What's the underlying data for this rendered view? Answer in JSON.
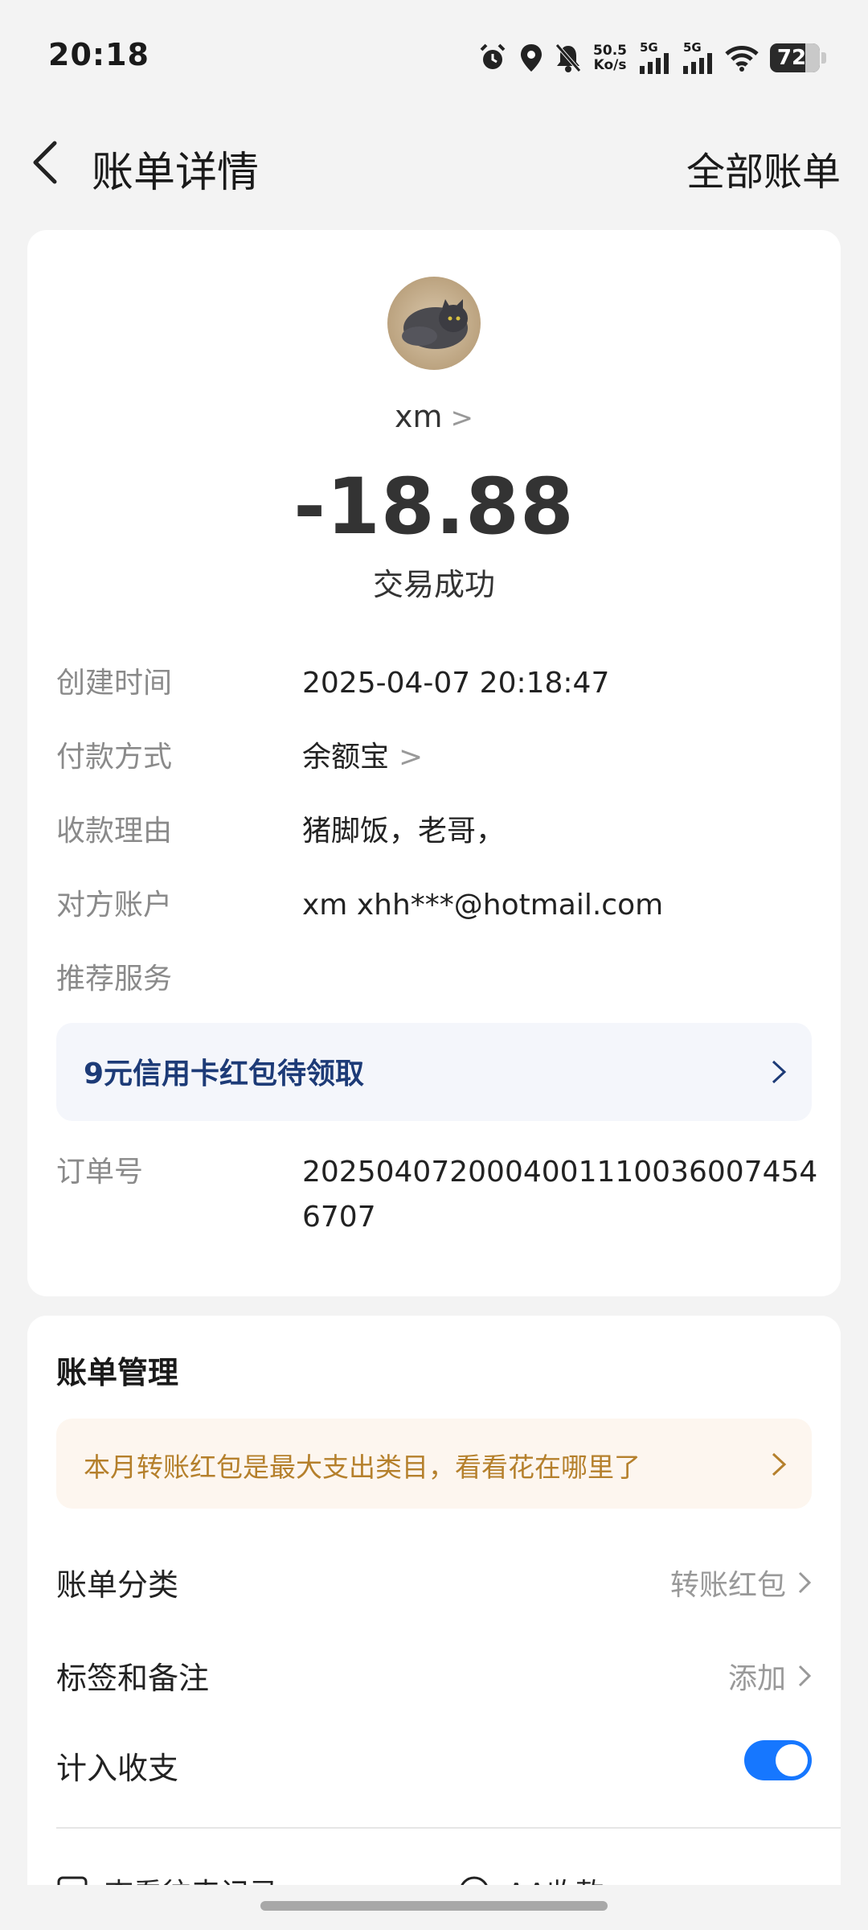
{
  "status_bar": {
    "time": "20:18",
    "net_speed_value": "50.5",
    "net_speed_unit": "Ko/s",
    "sim1_label": "5G",
    "sim2_label": "5G",
    "battery": "72",
    "icons": [
      "alarm-icon",
      "location-icon",
      "mute-bell-icon",
      "signal-icon",
      "signal-icon",
      "wifi-icon",
      "battery-icon"
    ]
  },
  "header": {
    "title": "账单详情",
    "all_bills": "全部账单"
  },
  "bill": {
    "payee": "xm",
    "amount": "-18.88",
    "status": "交易成功",
    "rows": [
      {
        "label": "创建时间",
        "value": "2025-04-07 20:18:47"
      },
      {
        "label": "付款方式",
        "value": "余额宝"
      },
      {
        "label": "收款理由",
        "value": "猪脚饭，老哥，"
      },
      {
        "label": "对方账户",
        "value": "xm xhh***@hotmail.com"
      },
      {
        "label": "推荐服务",
        "value": ""
      }
    ],
    "promo": "9元信用卡红包待领取",
    "order_label": "订单号",
    "order_no": "20250407200040011100360074546707"
  },
  "management": {
    "title": "账单管理",
    "tip": "本月转账红包是最大支出类目，看看花在哪里了",
    "category_label": "账单分类",
    "category_value": "转账红包",
    "tags_label": "标签和备注",
    "tags_value": "添加",
    "count_label": "计入收支",
    "count_enabled": true,
    "action1": "查看往来记录",
    "action2": "AA收款"
  },
  "colors": {
    "accent": "#1677ff",
    "promo_text": "#1d3b77",
    "tip_text": "#b5802c",
    "tip_bg": "#fdf6ef",
    "promo_bg": "#f4f6fb"
  }
}
